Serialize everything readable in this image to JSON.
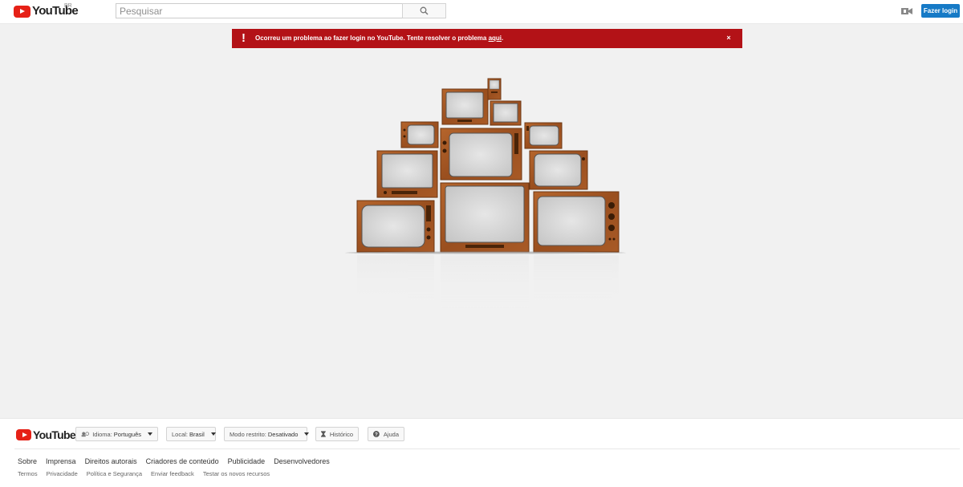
{
  "header": {
    "logo_text": "YouTube",
    "country_code": "BR",
    "search_placeholder": "Pesquisar",
    "signin_label": "Fazer login"
  },
  "alert": {
    "message": "Ocorreu um problema ao fazer login no YouTube. Tente resolver o problema ",
    "link_text": "aqui",
    "suffix": ".",
    "close_symbol": "×",
    "icon_symbol": "!"
  },
  "footer": {
    "logo_text": "YouTube",
    "language_label": "Idioma:",
    "language_value": "Português",
    "location_label": "Local:",
    "location_value": "Brasil",
    "restricted_label": "Modo restrito:",
    "restricted_value": "Desativado",
    "history_label": "Histórico",
    "help_label": "Ajuda",
    "primary_links": [
      "Sobre",
      "Imprensa",
      "Direitos autorais",
      "Criadores de conteúdo",
      "Publicidade",
      "Desenvolvedores"
    ],
    "secondary_links": [
      "Termos",
      "Privacidade",
      "Política e Segurança",
      "Enviar feedback",
      "Testar os novos recursos"
    ]
  },
  "colors": {
    "brand_red": "#e62117",
    "alert_red": "#b31217",
    "signin_blue": "#167ac6",
    "tv_wood": "#a0522d"
  },
  "icons": {
    "search": "search-icon",
    "upload": "video-camera-icon",
    "alert": "exclamation-icon",
    "close": "close-icon",
    "language": "language-icon",
    "history": "hourglass-icon",
    "help": "help-icon"
  }
}
